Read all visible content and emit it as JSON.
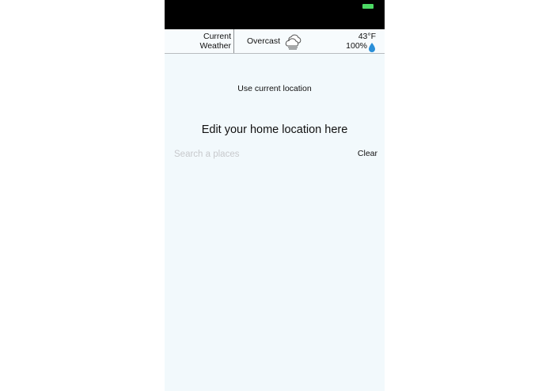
{
  "weather_bar": {
    "label_line1": "Current",
    "label_line2": "Weather",
    "condition": "Overcast",
    "condition_icon": "overcast-cloud-icon",
    "temperature": "43°F",
    "humidity": "100%",
    "humidity_icon": "water-drop-icon"
  },
  "main": {
    "use_current_location": "Use current location",
    "title": "Edit your home location here",
    "search_placeholder": "Search a places",
    "clear_label": "Clear"
  },
  "colors": {
    "background": "#f2f9fc",
    "status_bar": "#000000",
    "battery": "#4cd964",
    "drop": "#2a8fd8"
  }
}
